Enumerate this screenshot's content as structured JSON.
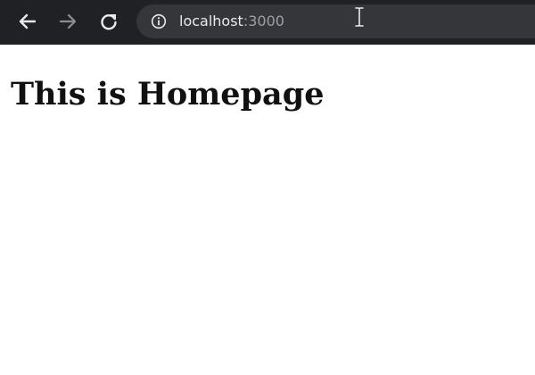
{
  "browser": {
    "address_bar": {
      "host": "localhost",
      "port": ":3000"
    },
    "icons": {
      "back": "back-arrow-icon",
      "forward": "forward-arrow-icon",
      "reload": "reload-icon",
      "site_info": "info-icon",
      "pointer": "text-cursor-icon"
    },
    "colors": {
      "toolbar_bg": "#202124",
      "omnibox_bg": "#35363a",
      "host_text": "#e8eaed",
      "port_text": "#9aa0a6"
    }
  },
  "page": {
    "heading": "This is Homepage",
    "background": "#ffffff"
  }
}
